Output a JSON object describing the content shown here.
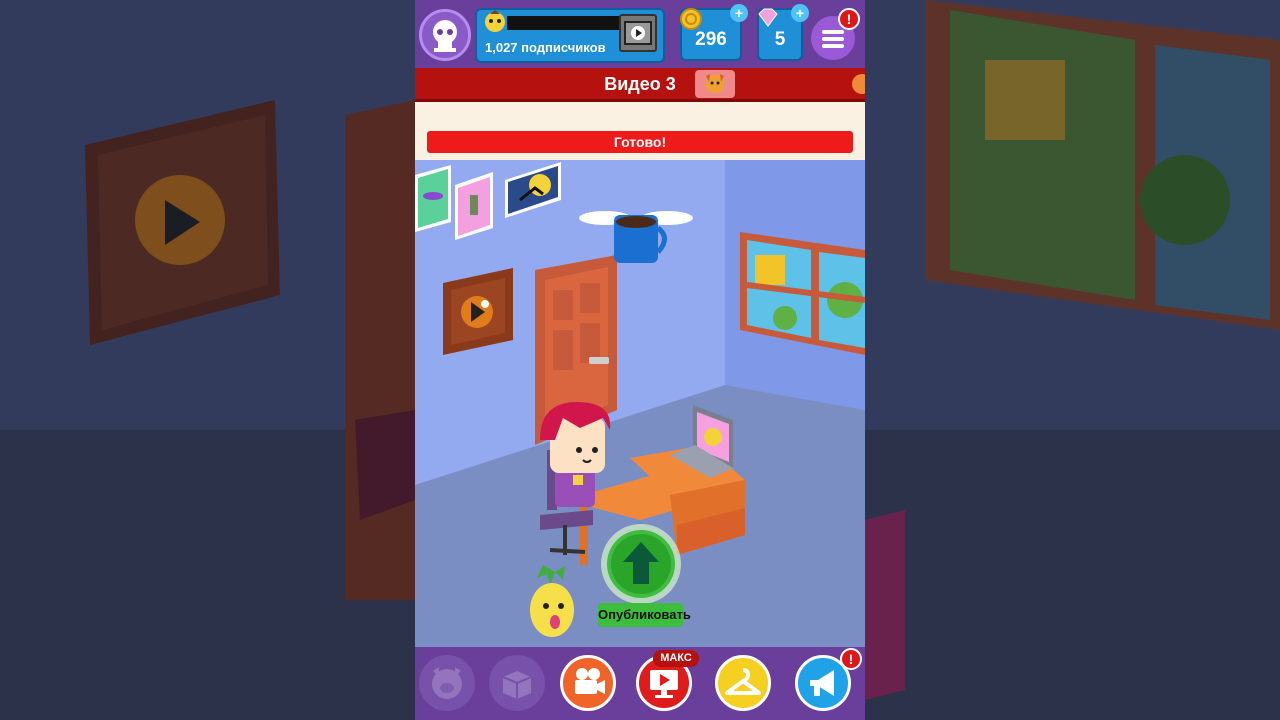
{
  "hud": {
    "subscribers": "1,027 подписчиков",
    "coins": "296",
    "gems": "5",
    "alert_mark": "!",
    "plus_mark": "+"
  },
  "video": {
    "title": "Видео 3",
    "status": "Готово!"
  },
  "actions": {
    "publish_label": "Опубликовать"
  },
  "bottom_nav": {
    "max_badge": "МАКС",
    "alert_mark": "!"
  },
  "icons": [
    "skull-avatar-icon",
    "subscriber-face-icon",
    "play-tv-icon",
    "coin-icon",
    "gem-icon",
    "menu-icon",
    "dog-face-icon",
    "coffee-cup-wings-icon",
    "upload-arrow-icon",
    "pig-icon",
    "box-icon",
    "camera-icon",
    "play-screen-icon",
    "hanger-icon",
    "megaphone-icon"
  ],
  "colors": {
    "hud_purple": "#6a3f9c",
    "panel_blue": "#1f8fd8",
    "banner_red": "#b5120f",
    "ready_red": "#ef1b1b",
    "publish_green": "#3cbd3c"
  }
}
